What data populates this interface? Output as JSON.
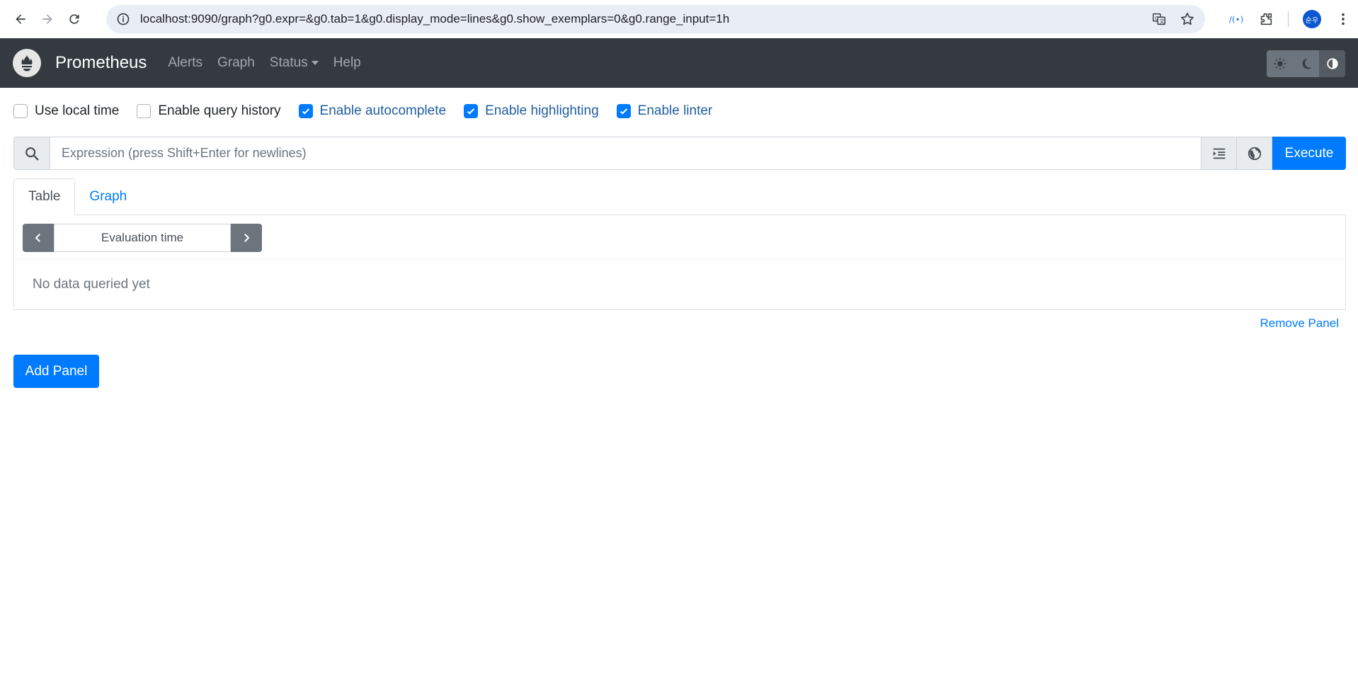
{
  "browser": {
    "url": "localhost:9090/graph?g0.expr=&g0.tab=1&g0.display_mode=lines&g0.show_exemplars=0&g0.range_input=1h",
    "profile_initials": "순우",
    "icons": [
      "back-icon",
      "forward-icon",
      "reload-icon",
      "site-info-icon",
      "translate-icon",
      "bookmark-star-icon",
      "extension-icon",
      "puzzle-icon",
      "menu-dots-icon"
    ]
  },
  "navbar": {
    "brand": "Prometheus",
    "links": [
      "Alerts",
      "Graph",
      "Status",
      "Help"
    ],
    "theme_icons": [
      "sun-icon",
      "moon-icon",
      "contrast-icon"
    ]
  },
  "options": [
    {
      "label": "Use local time",
      "checked": false
    },
    {
      "label": "Enable query history",
      "checked": false
    },
    {
      "label": "Enable autocomplete",
      "checked": true
    },
    {
      "label": "Enable highlighting",
      "checked": true
    },
    {
      "label": "Enable linter",
      "checked": true
    }
  ],
  "expression": {
    "placeholder": "Expression (press Shift+Enter for newlines)",
    "execute_label": "Execute"
  },
  "tabs": {
    "table": "Table",
    "graph": "Graph",
    "active": "Table"
  },
  "panel": {
    "evaluation_time": "Evaluation time",
    "no_data": "No data queried yet",
    "remove_label": "Remove Panel"
  },
  "add_panel_label": "Add Panel",
  "colors": {
    "navbar_bg": "#343a40",
    "primary": "#007bff",
    "secondary": "#6c757d"
  }
}
